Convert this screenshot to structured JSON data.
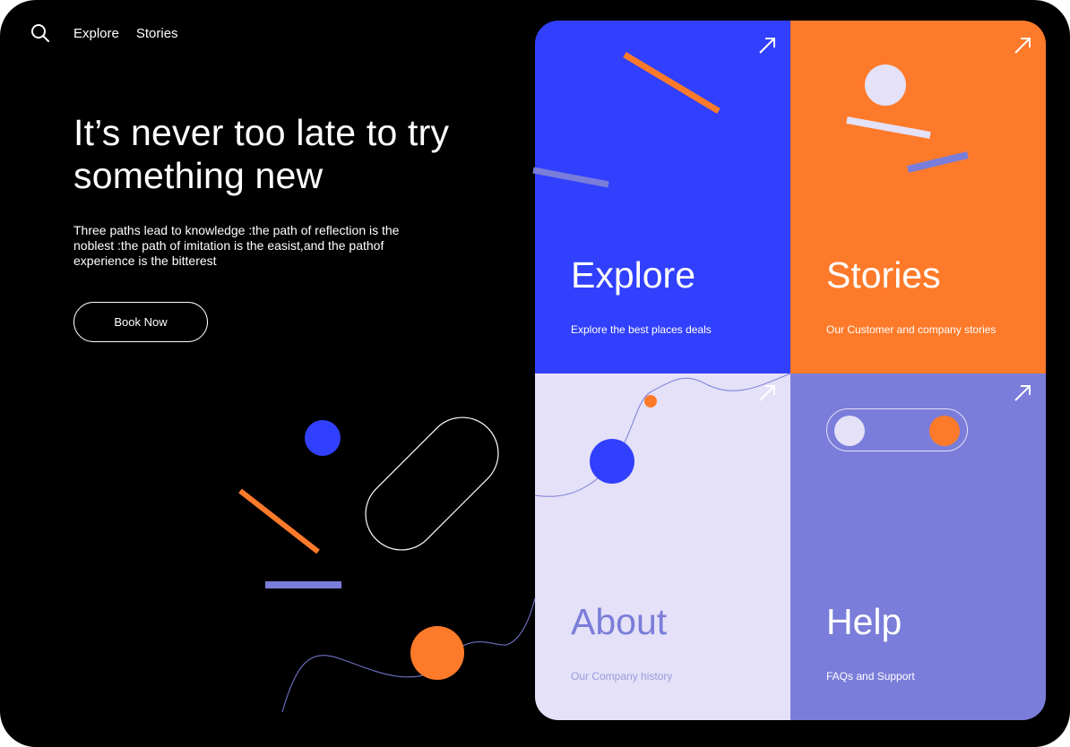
{
  "nav": {
    "search_icon": "search-icon",
    "explore_label": "Explore",
    "stories_label": "Stories"
  },
  "hero": {
    "title": "It’s never too late to try something new",
    "text": "Three paths lead to knowledge :the path of reflection is the noblest :the path of imitation is the easist,and the pathof experience is the bitterest",
    "button_label": "Book Now"
  },
  "tiles": [
    {
      "title": "Explore",
      "subtitle": "Explore the best places deals",
      "icon": "arrow-up-right-icon"
    },
    {
      "title": "Stories",
      "subtitle": "Our Customer and company stories",
      "icon": "arrow-up-right-icon"
    },
    {
      "title": "About",
      "subtitle": "Our Company history",
      "icon": "arrow-up-right-icon"
    },
    {
      "title": "Help",
      "subtitle": "FAQs and Support",
      "icon": "arrow-up-right-icon"
    }
  ],
  "colors": {
    "background": "#000000",
    "blue": "#3140fd",
    "orange": "#fd7a2a",
    "lavender": "#e4e1f8",
    "periwinkle": "#7a7dd9"
  }
}
